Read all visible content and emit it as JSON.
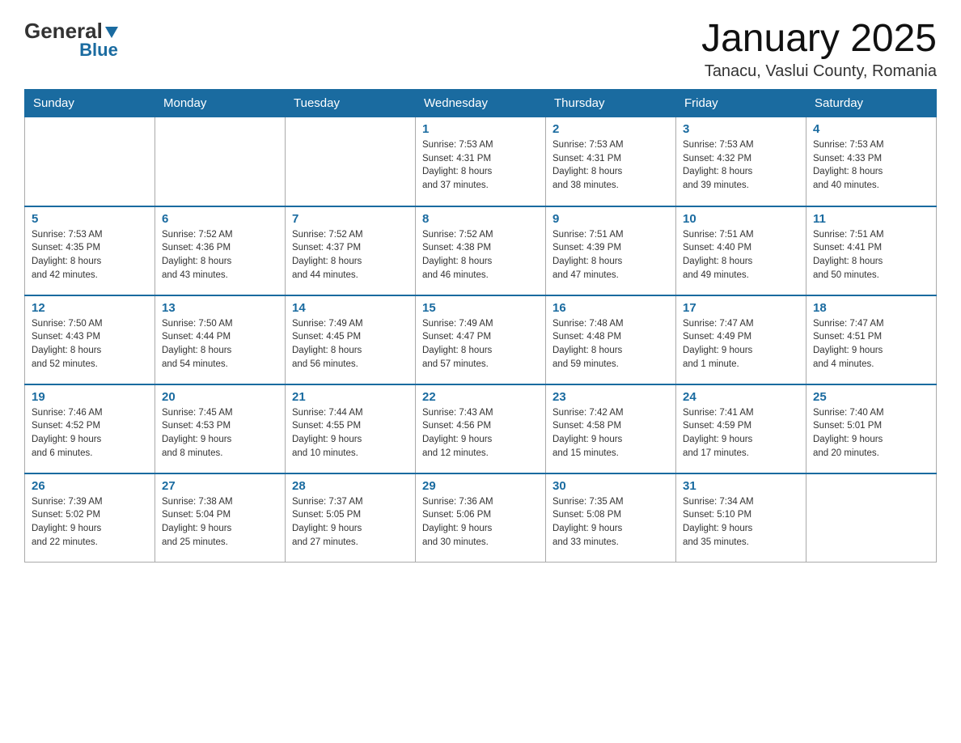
{
  "header": {
    "logo_general": "General",
    "logo_blue": "Blue",
    "month_title": "January 2025",
    "location": "Tanacu, Vaslui County, Romania"
  },
  "days_of_week": [
    "Sunday",
    "Monday",
    "Tuesday",
    "Wednesday",
    "Thursday",
    "Friday",
    "Saturday"
  ],
  "weeks": [
    [
      {
        "day": "",
        "info": ""
      },
      {
        "day": "",
        "info": ""
      },
      {
        "day": "",
        "info": ""
      },
      {
        "day": "1",
        "info": "Sunrise: 7:53 AM\nSunset: 4:31 PM\nDaylight: 8 hours\nand 37 minutes."
      },
      {
        "day": "2",
        "info": "Sunrise: 7:53 AM\nSunset: 4:31 PM\nDaylight: 8 hours\nand 38 minutes."
      },
      {
        "day": "3",
        "info": "Sunrise: 7:53 AM\nSunset: 4:32 PM\nDaylight: 8 hours\nand 39 minutes."
      },
      {
        "day": "4",
        "info": "Sunrise: 7:53 AM\nSunset: 4:33 PM\nDaylight: 8 hours\nand 40 minutes."
      }
    ],
    [
      {
        "day": "5",
        "info": "Sunrise: 7:53 AM\nSunset: 4:35 PM\nDaylight: 8 hours\nand 42 minutes."
      },
      {
        "day": "6",
        "info": "Sunrise: 7:52 AM\nSunset: 4:36 PM\nDaylight: 8 hours\nand 43 minutes."
      },
      {
        "day": "7",
        "info": "Sunrise: 7:52 AM\nSunset: 4:37 PM\nDaylight: 8 hours\nand 44 minutes."
      },
      {
        "day": "8",
        "info": "Sunrise: 7:52 AM\nSunset: 4:38 PM\nDaylight: 8 hours\nand 46 minutes."
      },
      {
        "day": "9",
        "info": "Sunrise: 7:51 AM\nSunset: 4:39 PM\nDaylight: 8 hours\nand 47 minutes."
      },
      {
        "day": "10",
        "info": "Sunrise: 7:51 AM\nSunset: 4:40 PM\nDaylight: 8 hours\nand 49 minutes."
      },
      {
        "day": "11",
        "info": "Sunrise: 7:51 AM\nSunset: 4:41 PM\nDaylight: 8 hours\nand 50 minutes."
      }
    ],
    [
      {
        "day": "12",
        "info": "Sunrise: 7:50 AM\nSunset: 4:43 PM\nDaylight: 8 hours\nand 52 minutes."
      },
      {
        "day": "13",
        "info": "Sunrise: 7:50 AM\nSunset: 4:44 PM\nDaylight: 8 hours\nand 54 minutes."
      },
      {
        "day": "14",
        "info": "Sunrise: 7:49 AM\nSunset: 4:45 PM\nDaylight: 8 hours\nand 56 minutes."
      },
      {
        "day": "15",
        "info": "Sunrise: 7:49 AM\nSunset: 4:47 PM\nDaylight: 8 hours\nand 57 minutes."
      },
      {
        "day": "16",
        "info": "Sunrise: 7:48 AM\nSunset: 4:48 PM\nDaylight: 8 hours\nand 59 minutes."
      },
      {
        "day": "17",
        "info": "Sunrise: 7:47 AM\nSunset: 4:49 PM\nDaylight: 9 hours\nand 1 minute."
      },
      {
        "day": "18",
        "info": "Sunrise: 7:47 AM\nSunset: 4:51 PM\nDaylight: 9 hours\nand 4 minutes."
      }
    ],
    [
      {
        "day": "19",
        "info": "Sunrise: 7:46 AM\nSunset: 4:52 PM\nDaylight: 9 hours\nand 6 minutes."
      },
      {
        "day": "20",
        "info": "Sunrise: 7:45 AM\nSunset: 4:53 PM\nDaylight: 9 hours\nand 8 minutes."
      },
      {
        "day": "21",
        "info": "Sunrise: 7:44 AM\nSunset: 4:55 PM\nDaylight: 9 hours\nand 10 minutes."
      },
      {
        "day": "22",
        "info": "Sunrise: 7:43 AM\nSunset: 4:56 PM\nDaylight: 9 hours\nand 12 minutes."
      },
      {
        "day": "23",
        "info": "Sunrise: 7:42 AM\nSunset: 4:58 PM\nDaylight: 9 hours\nand 15 minutes."
      },
      {
        "day": "24",
        "info": "Sunrise: 7:41 AM\nSunset: 4:59 PM\nDaylight: 9 hours\nand 17 minutes."
      },
      {
        "day": "25",
        "info": "Sunrise: 7:40 AM\nSunset: 5:01 PM\nDaylight: 9 hours\nand 20 minutes."
      }
    ],
    [
      {
        "day": "26",
        "info": "Sunrise: 7:39 AM\nSunset: 5:02 PM\nDaylight: 9 hours\nand 22 minutes."
      },
      {
        "day": "27",
        "info": "Sunrise: 7:38 AM\nSunset: 5:04 PM\nDaylight: 9 hours\nand 25 minutes."
      },
      {
        "day": "28",
        "info": "Sunrise: 7:37 AM\nSunset: 5:05 PM\nDaylight: 9 hours\nand 27 minutes."
      },
      {
        "day": "29",
        "info": "Sunrise: 7:36 AM\nSunset: 5:06 PM\nDaylight: 9 hours\nand 30 minutes."
      },
      {
        "day": "30",
        "info": "Sunrise: 7:35 AM\nSunset: 5:08 PM\nDaylight: 9 hours\nand 33 minutes."
      },
      {
        "day": "31",
        "info": "Sunrise: 7:34 AM\nSunset: 5:10 PM\nDaylight: 9 hours\nand 35 minutes."
      },
      {
        "day": "",
        "info": ""
      }
    ]
  ]
}
